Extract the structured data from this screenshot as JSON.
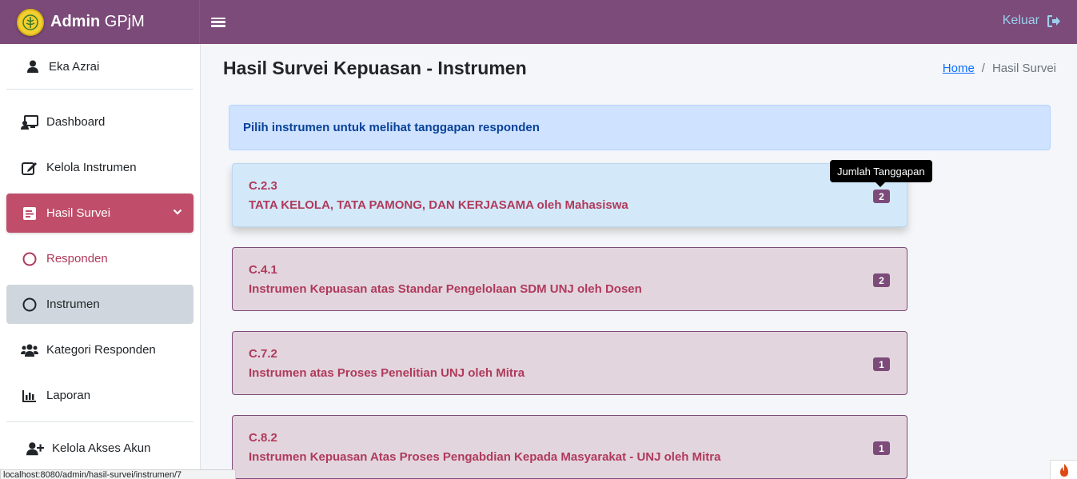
{
  "header": {
    "brand_bold": "Admin",
    "brand_rest": " GPjM",
    "logout_label": "Keluar"
  },
  "sidebar": {
    "user_name": "Eka Azrai",
    "items": [
      {
        "label": "Dashboard",
        "icon": "dashboard-icon"
      },
      {
        "label": "Kelola Instrumen",
        "icon": "edit-icon"
      },
      {
        "label": "Hasil Survei",
        "icon": "poll-icon"
      },
      {
        "label": "Responden",
        "icon": "circle-icon"
      },
      {
        "label": "Instrumen",
        "icon": "circle-icon"
      },
      {
        "label": "Kategori Responden",
        "icon": "users-icon"
      },
      {
        "label": "Laporan",
        "icon": "chart-bar-icon"
      },
      {
        "label": "Kelola Akses Akun",
        "icon": "user-plus-icon"
      }
    ]
  },
  "main": {
    "title": "Hasil Survei Kepuasan - Instrumen",
    "breadcrumb": {
      "home": "Home",
      "separator": "/",
      "current": "Hasil Survei"
    },
    "alert": "Pilih instrumen untuk melihat tanggapan responden",
    "tooltip": "Jumlah Tanggapan",
    "instruments": [
      {
        "code": "C.2.3",
        "title": "TATA KELOLA, TATA PAMONG, DAN KERJASAMA oleh Mahasiswa",
        "count": "2"
      },
      {
        "code": "C.4.1",
        "title": "Instrumen Kepuasan atas Standar Pengelolaan SDM UNJ oleh Dosen",
        "count": "2"
      },
      {
        "code": "C.7.2",
        "title": "Instrumen atas Proses Penelitian UNJ oleh Mitra",
        "count": "1"
      },
      {
        "code": "C.8.2",
        "title": "Instrumen Kepuasan Atas Proses Pengabdian Kepada Masyarakat - UNJ oleh Mitra",
        "count": "1"
      }
    ]
  },
  "statusbar": {
    "url": "localhost:8080/admin/hasil-survei/instrumen/7"
  },
  "colors": {
    "primary": "#7c4b79",
    "accent": "#c04e6a",
    "card_bg": "#e2d5de",
    "hover_bg": "#d3e8f8"
  }
}
